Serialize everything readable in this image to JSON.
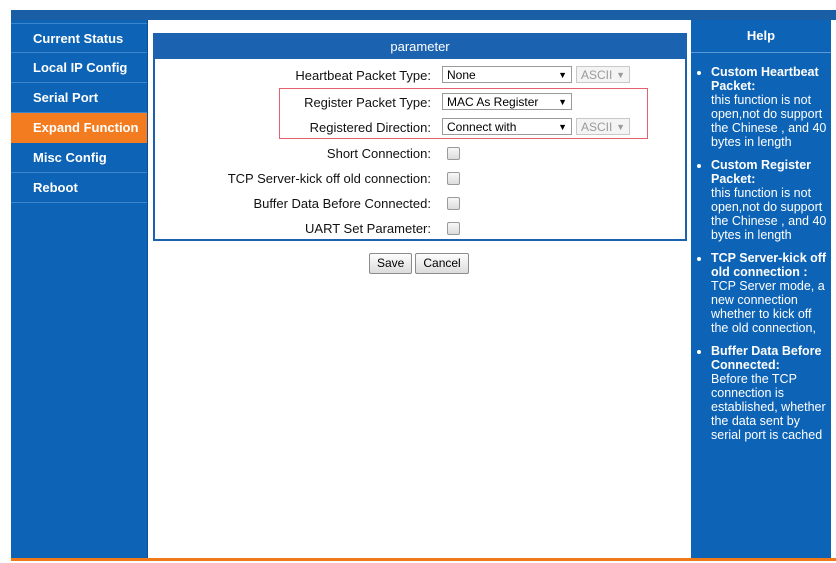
{
  "nav": {
    "items": [
      {
        "label": "Current Status",
        "active": false
      },
      {
        "label": "Local IP Config",
        "active": false
      },
      {
        "label": "Serial Port",
        "active": false
      },
      {
        "label": "Expand Function",
        "active": true
      },
      {
        "label": "Misc Config",
        "active": false
      },
      {
        "label": "Reboot",
        "active": false
      }
    ]
  },
  "panel": {
    "title": "parameter",
    "heartbeat": {
      "label": "Heartbeat Packet Type:",
      "value": "None",
      "format": "ASCII"
    },
    "register": {
      "label": "Register Packet Type:",
      "value": "MAC As Register"
    },
    "direction": {
      "label": "Registered Direction:",
      "value": "Connect with",
      "format": "ASCII"
    },
    "short_connection": {
      "label": "Short Connection:",
      "checked": false
    },
    "tcp_kick": {
      "label": "TCP Server-kick off old connection:",
      "checked": false
    },
    "buffer_data": {
      "label": "Buffer Data Before Connected:",
      "checked": false
    },
    "uart_set": {
      "label": "UART Set Parameter:",
      "checked": false
    }
  },
  "buttons": {
    "save": "Save",
    "cancel": "Cancel"
  },
  "help": {
    "title": "Help",
    "items": [
      {
        "title": "Custom Heartbeat Packet:",
        "body": "this function is not open,not do support the Chinese , and 40 bytes in length"
      },
      {
        "title": "Custom Register Packet:",
        "body": "this function is not open,not do support the Chinese , and 40 bytes in length"
      },
      {
        "title": "TCP Server-kick off old connection :",
        "body": "TCP Server mode, a new connection whether to kick off the old connection,"
      },
      {
        "title": "Buffer Data Before Connected:",
        "body": "Before the TCP connection is established, whether the data sent by serial port is cached"
      }
    ]
  },
  "colors": {
    "nav_bg": "#0d63b5",
    "active": "#f47c20",
    "header": "#1b63b0",
    "highlight": "#e5606b"
  }
}
